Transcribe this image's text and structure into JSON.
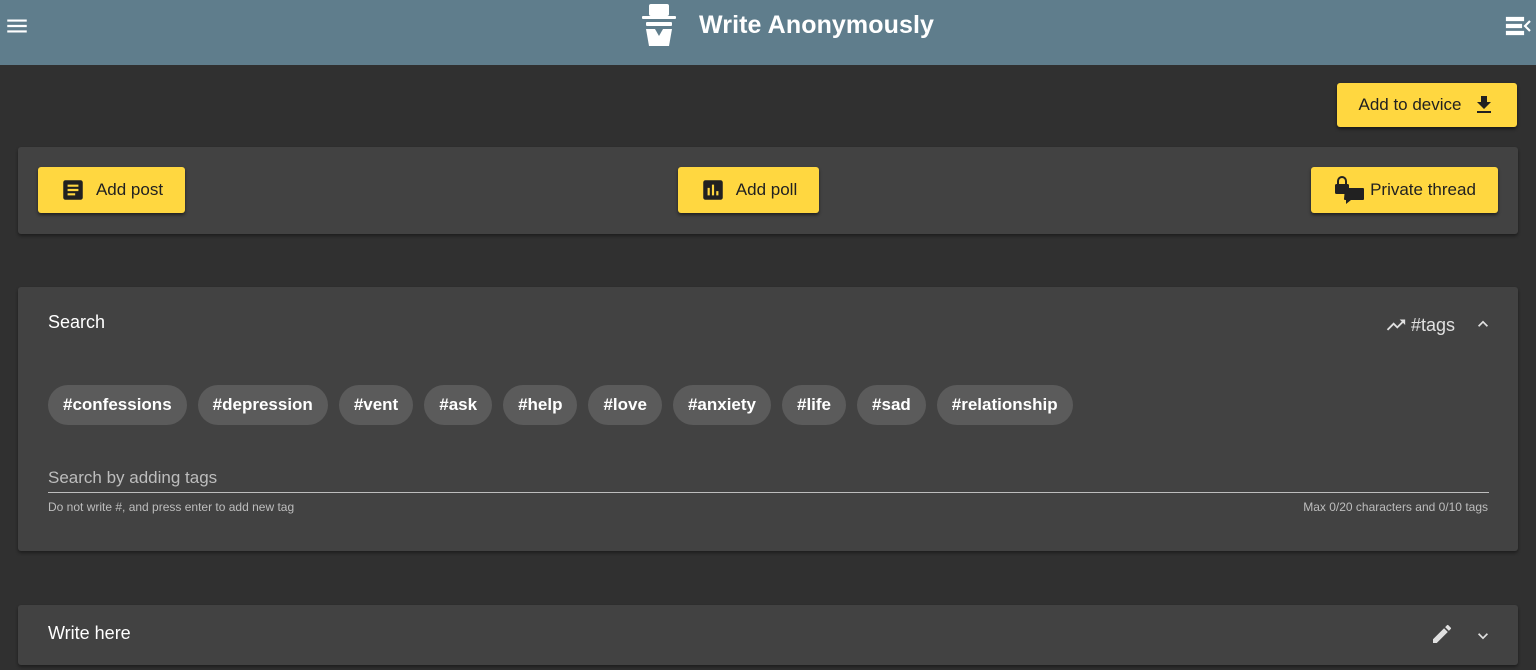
{
  "header": {
    "title": "Write Anonymously",
    "logo_icon": "incognito-icon",
    "menu_icon": "menu-icon",
    "sidebar_icon": "menu-open-icon",
    "background": "#5f7d8c"
  },
  "toolbar": {
    "add_to_device_label": "Add to device"
  },
  "actions": {
    "add_post_label": "Add post",
    "add_poll_label": "Add poll",
    "private_thread_label": "Private thread"
  },
  "search": {
    "title": "Search",
    "trending_label": "#tags",
    "tags": [
      "#confessions",
      "#depression",
      "#vent",
      "#ask",
      "#help",
      "#love",
      "#anxiety",
      "#life",
      "#sad",
      "#relationship"
    ],
    "placeholder": "Search by adding tags",
    "value": "",
    "hint": "Do not write #, and press enter to add new tag",
    "counter": "Max 0/20 characters and 0/10 tags"
  },
  "write": {
    "title": "Write here"
  },
  "colors": {
    "accent": "#ffd740",
    "page_background": "#303030",
    "card_background": "#424242",
    "chip_background": "#5b5b5b"
  }
}
